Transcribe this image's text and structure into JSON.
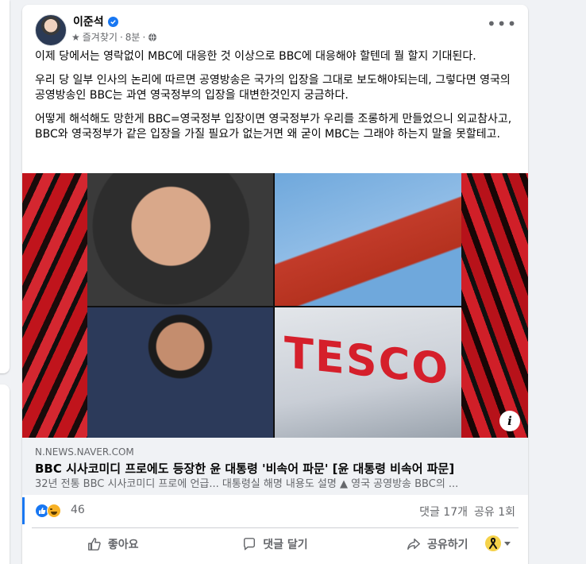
{
  "post": {
    "author": "이준석",
    "meta": {
      "audience": "즐겨찾기",
      "separator": "·",
      "time": "8분",
      "privacy_icon": "globe-icon"
    },
    "more_icon": "more-icon",
    "body": [
      "이제 당에서는 영락없이 MBC에 대응한 것 이상으로 BBC에 대응해야 할텐데 뭘 할지 기대된다.",
      "우리 당 일부 인사의 논리에 따르면 공영방송은 국가의 입장을 그대로 보도해야되는데, 그렇다면 영국의 공영방송인 BBC는 과연 영국정부의 입장을 대변한것인지 궁금하다.",
      "어떻게 해석해도 망한게 BBC=영국정부 입장이면 영국정부가 우리를 조롱하게 만들었으니 외교참사고,\nBBC와 영국정부가 같은 입장을 가질 필요가 없는거면 왜 굳이 MBC는 그래야 하는지 말을 못할테고."
    ],
    "link": {
      "domain": "N.NEWS.NAVER.COM",
      "title": "BBC 시사코미디 프로에도 등장한 윤 대통령 '비속어 파문' [윤 대통령 비속어 파문]",
      "description": "32년 전통 BBC 시사코미디 프로에 언급... 대통령실 해명 내용도 설명 ▲ 영국 공영방송 BBC의 ...",
      "image_text": "TESCO",
      "info_icon": "i"
    },
    "reactions": {
      "count": "46",
      "comments": "댓글 17개",
      "shares": "공유 1회"
    },
    "actions": {
      "like": "좋아요",
      "comment": "댓글 달기",
      "share": "공유하기"
    },
    "colors": {
      "accent": "#1877f2",
      "muted": "#65676b"
    }
  }
}
